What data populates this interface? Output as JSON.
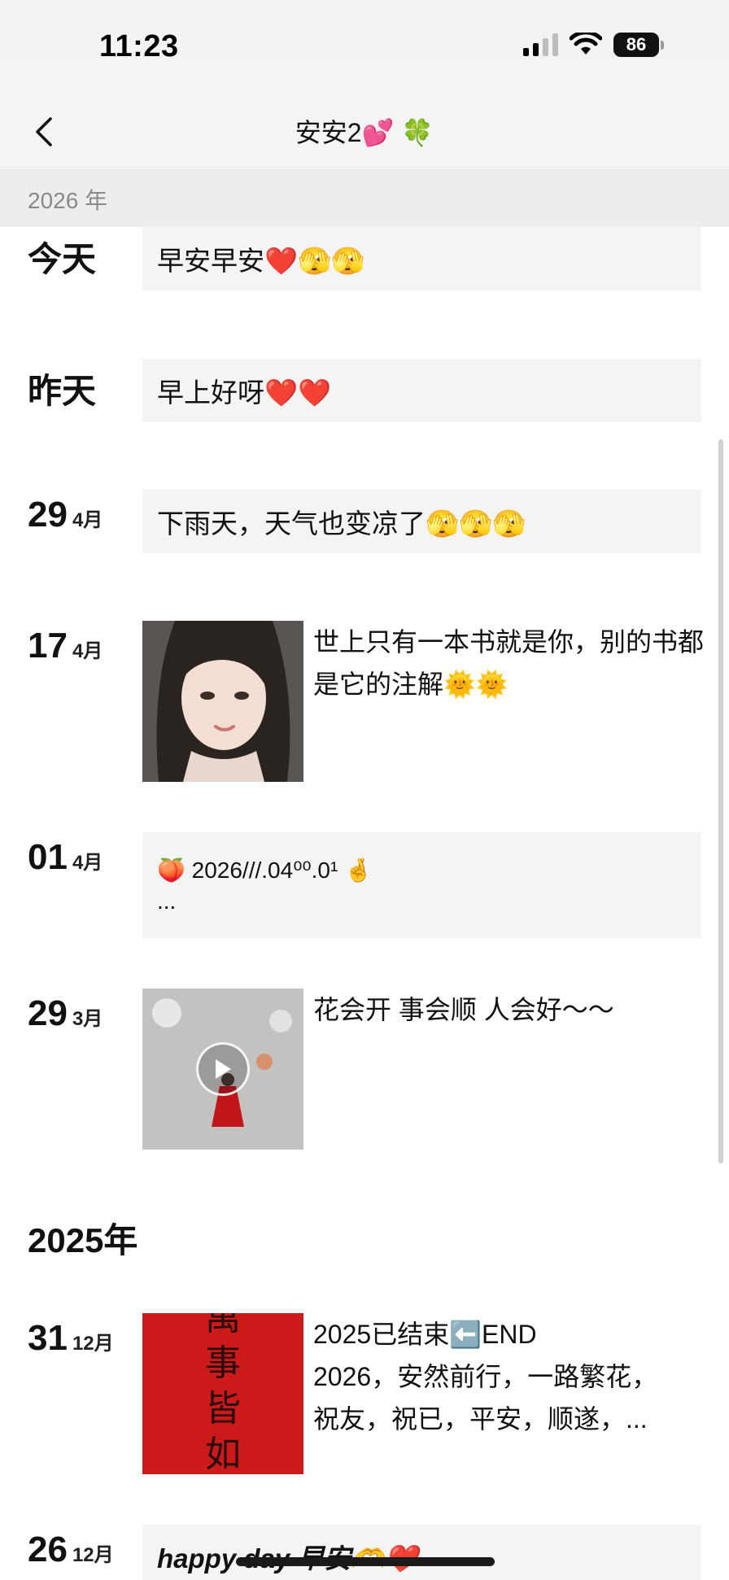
{
  "status_bar": {
    "time": "11:23",
    "battery": "86"
  },
  "nav": {
    "title": "安安2💕 🍀"
  },
  "sticky_year": "2026 年",
  "entries": [
    {
      "day": "今天",
      "text": "早安早安❤️🫣🫣"
    },
    {
      "day": "昨天",
      "text": "早上好呀❤️❤️"
    },
    {
      "day": "29",
      "month": "4月",
      "text": "下雨天，天气也变凉了🫣🫣🫣"
    },
    {
      "day": "17",
      "month": "4月",
      "text": "世上只有一本书就是你，别的书都是它的注解🌞🌞"
    },
    {
      "day": "01",
      "month": "4月",
      "line1": "🍑 2026///.04⁰⁰.0¹ 🤞",
      "line2": "..."
    },
    {
      "day": "29",
      "month": "3月",
      "text": "花会开 事会顺 人会好～～"
    }
  ],
  "year_2025": "2025年",
  "entries_2025": [
    {
      "day": "31",
      "month": "12月",
      "line1": "2025已结束⬅️END",
      "line2": "2026，安然前行，一路繁花，",
      "line3": "祝友，祝已，平安，顺遂，...",
      "image_text": "萬事皆如意"
    },
    {
      "day": "26",
      "month": "12月",
      "text": "happy day 早安🫶❤️"
    }
  ]
}
